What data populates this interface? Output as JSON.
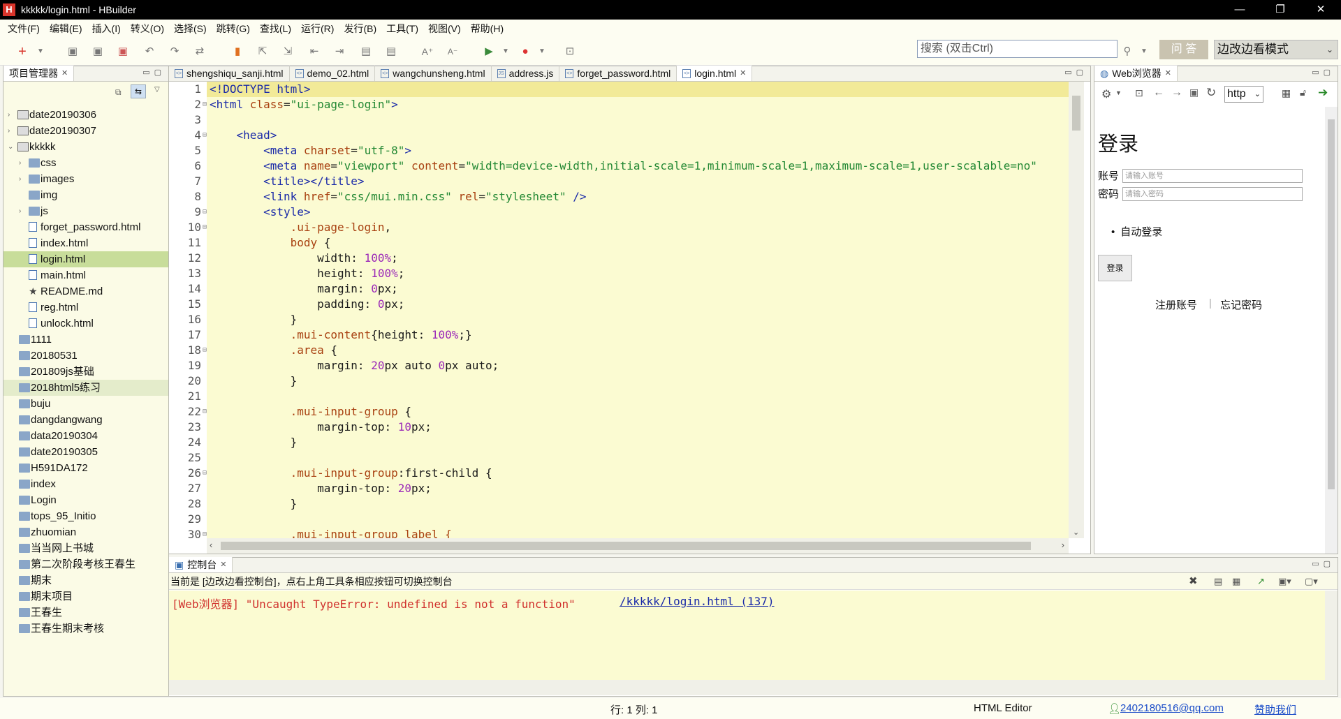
{
  "window": {
    "title": "kkkkk/login.html - HBuilder",
    "app_icon": "H",
    "minimize": "—",
    "maximize": "❐",
    "close": "✕"
  },
  "menu": [
    "文件(F)",
    "编辑(E)",
    "插入(I)",
    "转义(O)",
    "选择(S)",
    "跳转(G)",
    "查找(L)",
    "运行(R)",
    "发行(B)",
    "工具(T)",
    "视图(V)",
    "帮助(H)"
  ],
  "toolbar": {
    "search_placeholder": "搜索 (双击Ctrl)",
    "ask_label": "问 答",
    "mode_label": "边改边看模式"
  },
  "project_explorer": {
    "tab_label": "项目管理器",
    "items": [
      {
        "label": "date20190306",
        "type": "project",
        "level": 0,
        "arrow": "›"
      },
      {
        "label": "date20190307",
        "type": "project",
        "level": 0,
        "arrow": "›"
      },
      {
        "label": "kkkkk",
        "type": "project",
        "level": 0,
        "arrow": "⌄"
      },
      {
        "label": "css",
        "type": "folder",
        "level": 1,
        "arrow": "›"
      },
      {
        "label": "images",
        "type": "folder",
        "level": 1,
        "arrow": "›"
      },
      {
        "label": "img",
        "type": "folder",
        "level": 1,
        "arrow": ""
      },
      {
        "label": "js",
        "type": "folder",
        "level": 1,
        "arrow": "›"
      },
      {
        "label": "forget_password.html",
        "type": "file",
        "level": 1,
        "arrow": ""
      },
      {
        "label": "index.html",
        "type": "file",
        "level": 1,
        "arrow": ""
      },
      {
        "label": "login.html",
        "type": "file",
        "level": 1,
        "arrow": "",
        "selected": true
      },
      {
        "label": "main.html",
        "type": "file",
        "level": 1,
        "arrow": ""
      },
      {
        "label": "README.md",
        "type": "star",
        "level": 1,
        "arrow": ""
      },
      {
        "label": "reg.html",
        "type": "file",
        "level": 1,
        "arrow": ""
      },
      {
        "label": "unlock.html",
        "type": "file",
        "level": 1,
        "arrow": ""
      },
      {
        "label": "1111",
        "type": "folder",
        "level": 0,
        "arrow": ""
      },
      {
        "label": "20180531",
        "type": "folder",
        "level": 0,
        "arrow": ""
      },
      {
        "label": "201809js基础",
        "type": "folder",
        "level": 0,
        "arrow": ""
      },
      {
        "label": "2018html5练习",
        "type": "folder",
        "level": 0,
        "arrow": "",
        "hover": true
      },
      {
        "label": "buju",
        "type": "folder",
        "level": 0,
        "arrow": ""
      },
      {
        "label": "dangdangwang",
        "type": "folder",
        "level": 0,
        "arrow": ""
      },
      {
        "label": "data20190304",
        "type": "folder",
        "level": 0,
        "arrow": ""
      },
      {
        "label": "date20190305",
        "type": "folder",
        "level": 0,
        "arrow": ""
      },
      {
        "label": "H591DA172",
        "type": "folder",
        "level": 0,
        "arrow": ""
      },
      {
        "label": "index",
        "type": "folder",
        "level": 0,
        "arrow": ""
      },
      {
        "label": "Login",
        "type": "folder",
        "level": 0,
        "arrow": ""
      },
      {
        "label": "tops_95_Initio",
        "type": "folder",
        "level": 0,
        "arrow": ""
      },
      {
        "label": "zhuomian",
        "type": "folder",
        "level": 0,
        "arrow": ""
      },
      {
        "label": "当当网上书城",
        "type": "folder",
        "level": 0,
        "arrow": ""
      },
      {
        "label": "第二次阶段考核王春生",
        "type": "folder",
        "level": 0,
        "arrow": ""
      },
      {
        "label": "期末",
        "type": "folder",
        "level": 0,
        "arrow": ""
      },
      {
        "label": "期末项目",
        "type": "folder",
        "level": 0,
        "arrow": ""
      },
      {
        "label": "王春生",
        "type": "folder",
        "level": 0,
        "arrow": ""
      },
      {
        "label": "王春生期末考核",
        "type": "folder",
        "level": 0,
        "arrow": ""
      }
    ]
  },
  "editor": {
    "tabs": [
      {
        "label": "shengshiqu_sanji.html",
        "icon": "<>"
      },
      {
        "label": "demo_02.html",
        "icon": "<>"
      },
      {
        "label": "wangchunsheng.html",
        "icon": "<>"
      },
      {
        "label": "address.js",
        "icon": "JS"
      },
      {
        "label": "forget_password.html",
        "icon": "<>"
      },
      {
        "label": "login.html",
        "icon": "<>",
        "active": true
      }
    ],
    "lines": [
      {
        "n": "1",
        "fold": "",
        "segs": [
          [
            "t-tag",
            "<!DOCTYPE html>"
          ]
        ],
        "current": true
      },
      {
        "n": "2",
        "fold": "⊟",
        "segs": [
          [
            "t-tag",
            "<html "
          ],
          [
            "t-attr",
            "class"
          ],
          [
            "t-prop",
            "="
          ],
          [
            "t-str",
            "\"ui-page-login\""
          ],
          [
            "t-tag",
            ">"
          ]
        ]
      },
      {
        "n": "3",
        "fold": "",
        "segs": []
      },
      {
        "n": "4",
        "fold": "⊟",
        "segs": [
          [
            "t-prop",
            "    "
          ],
          [
            "t-tag",
            "<head>"
          ]
        ]
      },
      {
        "n": "5",
        "fold": "",
        "segs": [
          [
            "t-prop",
            "        "
          ],
          [
            "t-tag",
            "<meta "
          ],
          [
            "t-attr",
            "charset"
          ],
          [
            "t-prop",
            "="
          ],
          [
            "t-str",
            "\"utf-8\""
          ],
          [
            "t-tag",
            ">"
          ]
        ]
      },
      {
        "n": "6",
        "fold": "",
        "segs": [
          [
            "t-prop",
            "        "
          ],
          [
            "t-tag",
            "<meta "
          ],
          [
            "t-attr",
            "name"
          ],
          [
            "t-prop",
            "="
          ],
          [
            "t-str",
            "\"viewport\""
          ],
          [
            "t-prop",
            " "
          ],
          [
            "t-attr",
            "content"
          ],
          [
            "t-prop",
            "="
          ],
          [
            "t-str",
            "\"width=device-width,initial-scale=1,minimum-scale=1,maximum-scale=1,user-scalable=no\""
          ]
        ]
      },
      {
        "n": "7",
        "fold": "",
        "segs": [
          [
            "t-prop",
            "        "
          ],
          [
            "t-tag",
            "<title></title>"
          ]
        ]
      },
      {
        "n": "8",
        "fold": "",
        "segs": [
          [
            "t-prop",
            "        "
          ],
          [
            "t-tag",
            "<link "
          ],
          [
            "t-attr",
            "href"
          ],
          [
            "t-prop",
            "="
          ],
          [
            "t-str",
            "\"css/mui.min.css\""
          ],
          [
            "t-prop",
            " "
          ],
          [
            "t-attr",
            "rel"
          ],
          [
            "t-prop",
            "="
          ],
          [
            "t-str",
            "\"stylesheet\""
          ],
          [
            "t-tag",
            " />"
          ]
        ]
      },
      {
        "n": "9",
        "fold": "⊟",
        "segs": [
          [
            "t-prop",
            "        "
          ],
          [
            "t-tag",
            "<style>"
          ]
        ]
      },
      {
        "n": "10",
        "fold": "⊟",
        "segs": [
          [
            "t-prop",
            "            "
          ],
          [
            "t-sel",
            ".ui-page-login"
          ],
          [
            "t-prop",
            ","
          ]
        ]
      },
      {
        "n": "11",
        "fold": "",
        "segs": [
          [
            "t-prop",
            "            "
          ],
          [
            "t-sel",
            "body"
          ],
          [
            "t-prop",
            " {"
          ]
        ]
      },
      {
        "n": "12",
        "fold": "",
        "segs": [
          [
            "t-prop",
            "                width: "
          ],
          [
            "t-num",
            "100%"
          ],
          [
            "t-prop",
            ";"
          ]
        ]
      },
      {
        "n": "13",
        "fold": "",
        "segs": [
          [
            "t-prop",
            "                height: "
          ],
          [
            "t-num",
            "100%"
          ],
          [
            "t-prop",
            ";"
          ]
        ]
      },
      {
        "n": "14",
        "fold": "",
        "segs": [
          [
            "t-prop",
            "                margin: "
          ],
          [
            "t-num",
            "0"
          ],
          [
            "t-prop",
            "px;"
          ]
        ]
      },
      {
        "n": "15",
        "fold": "",
        "segs": [
          [
            "t-prop",
            "                padding: "
          ],
          [
            "t-num",
            "0"
          ],
          [
            "t-prop",
            "px;"
          ]
        ]
      },
      {
        "n": "16",
        "fold": "",
        "segs": [
          [
            "t-prop",
            "            }"
          ]
        ]
      },
      {
        "n": "17",
        "fold": "",
        "segs": [
          [
            "t-prop",
            "            "
          ],
          [
            "t-sel",
            ".mui-content"
          ],
          [
            "t-prop",
            "{height: "
          ],
          [
            "t-num",
            "100%"
          ],
          [
            "t-prop",
            ";}"
          ]
        ]
      },
      {
        "n": "18",
        "fold": "⊟",
        "segs": [
          [
            "t-prop",
            "            "
          ],
          [
            "t-sel",
            ".area"
          ],
          [
            "t-prop",
            " {"
          ]
        ]
      },
      {
        "n": "19",
        "fold": "",
        "segs": [
          [
            "t-prop",
            "                margin: "
          ],
          [
            "t-num",
            "20"
          ],
          [
            "t-prop",
            "px auto "
          ],
          [
            "t-num",
            "0"
          ],
          [
            "t-prop",
            "px auto;"
          ]
        ]
      },
      {
        "n": "20",
        "fold": "",
        "segs": [
          [
            "t-prop",
            "            }"
          ]
        ]
      },
      {
        "n": "21",
        "fold": "",
        "segs": []
      },
      {
        "n": "22",
        "fold": "⊟",
        "segs": [
          [
            "t-prop",
            "            "
          ],
          [
            "t-sel",
            ".mui-input-group"
          ],
          [
            "t-prop",
            " {"
          ]
        ]
      },
      {
        "n": "23",
        "fold": "",
        "segs": [
          [
            "t-prop",
            "                margin-top: "
          ],
          [
            "t-num",
            "10"
          ],
          [
            "t-prop",
            "px;"
          ]
        ]
      },
      {
        "n": "24",
        "fold": "",
        "segs": [
          [
            "t-prop",
            "            }"
          ]
        ]
      },
      {
        "n": "25",
        "fold": "",
        "segs": []
      },
      {
        "n": "26",
        "fold": "⊟",
        "segs": [
          [
            "t-prop",
            "            "
          ],
          [
            "t-sel",
            ".mui-input-group"
          ],
          [
            "t-prop",
            ":first-child {"
          ]
        ]
      },
      {
        "n": "27",
        "fold": "",
        "segs": [
          [
            "t-prop",
            "                margin-top: "
          ],
          [
            "t-num",
            "20"
          ],
          [
            "t-prop",
            "px;"
          ]
        ]
      },
      {
        "n": "28",
        "fold": "",
        "segs": [
          [
            "t-prop",
            "            }"
          ]
        ]
      },
      {
        "n": "29",
        "fold": "",
        "segs": []
      },
      {
        "n": "30",
        "fold": "⊟",
        "segs": [
          [
            "t-prop",
            "            "
          ],
          [
            "t-sel",
            ".mui-input-group label {"
          ]
        ]
      }
    ]
  },
  "browser": {
    "tab_label": "Web浏览器",
    "url_scheme": "http",
    "page": {
      "title": "登录",
      "account_label": "账号",
      "account_placeholder": "请输入账号",
      "password_label": "密码",
      "password_placeholder": "请输入密码",
      "auto_login": "自动登录",
      "login_button": "登录",
      "register_link": "注册账号",
      "separator": "|",
      "forgot_link": "忘记密码"
    }
  },
  "console": {
    "tab_label": "控制台",
    "info": "当前是 [边改边看控制台]，点右上角工具条相应按钮可切换控制台",
    "message": "[Web浏览器] \"Uncaught TypeError: undefined is not a function\"",
    "link": "/kkkkk/login.html (137)"
  },
  "status": {
    "position": "行: 1 列: 1",
    "editor_type": "HTML Editor",
    "email": "2402180516@qq.com",
    "sponsor": "赞助我们"
  }
}
